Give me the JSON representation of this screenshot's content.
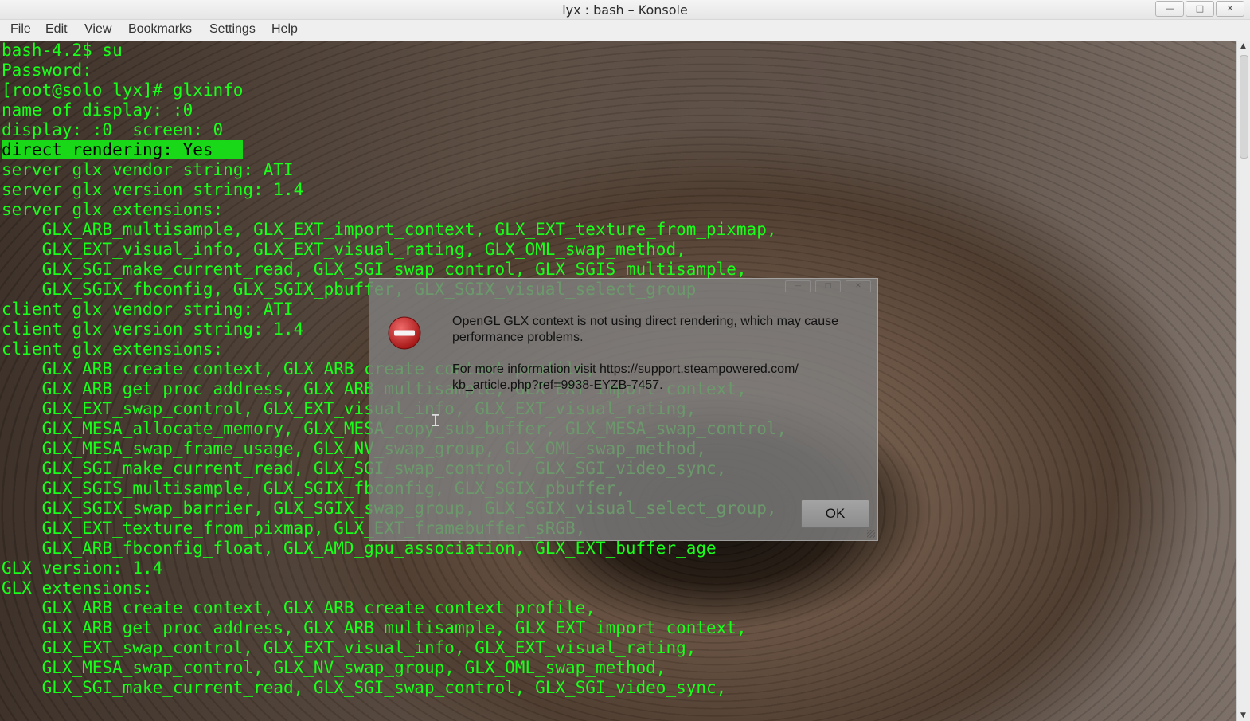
{
  "window": {
    "title": "lyx : bash – Konsole",
    "controls": [
      "minimize-icon",
      "maximize-icon",
      "close-icon"
    ]
  },
  "menubar": {
    "items": [
      "File",
      "Edit",
      "View",
      "Bookmarks",
      "Settings",
      "Help"
    ]
  },
  "terminal": {
    "text_color": "#1aff1a",
    "highlight_color": "#18d818",
    "lines": [
      "bash-4.2$ su",
      "Password:",
      "[root@solo lyx]# glxinfo",
      "name of display: :0",
      "display: :0  screen: 0",
      "direct rendering: Yes   ",
      "server glx vendor string: ATI",
      "server glx version string: 1.4",
      "server glx extensions:",
      "    GLX_ARB_multisample, GLX_EXT_import_context, GLX_EXT_texture_from_pixmap,",
      "    GLX_EXT_visual_info, GLX_EXT_visual_rating, GLX_OML_swap_method,",
      "    GLX_SGI_make_current_read, GLX_SGI_swap_control, GLX_SGIS_multisample,",
      "    GLX_SGIX_fbconfig, GLX_SGIX_pbuffer, GLX_SGIX_visual_select_group",
      "client glx vendor string: ATI",
      "client glx version string: 1.4",
      "client glx extensions:",
      "    GLX_ARB_create_context, GLX_ARB_create_context_profile,",
      "    GLX_ARB_get_proc_address, GLX_ARB_multisample, GLX_EXT_import_context,",
      "    GLX_EXT_swap_control, GLX_EXT_visual_info, GLX_EXT_visual_rating,",
      "    GLX_MESA_allocate_memory, GLX_MESA_copy_sub_buffer, GLX_MESA_swap_control,",
      "    GLX_MESA_swap_frame_usage, GLX_NV_swap_group, GLX_OML_swap_method,",
      "    GLX_SGI_make_current_read, GLX_SGI_swap_control, GLX_SGI_video_sync,",
      "    GLX_SGIS_multisample, GLX_SGIX_fbconfig, GLX_SGIX_pbuffer,",
      "    GLX_SGIX_swap_barrier, GLX_SGIX_swap_group, GLX_SGIX_visual_select_group,",
      "    GLX_EXT_texture_from_pixmap, GLX_EXT_framebuffer_sRGB,",
      "    GLX_ARB_fbconfig_float, GLX_AMD_gpu_association, GLX_EXT_buffer_age",
      "GLX version: 1.4",
      "GLX extensions:",
      "    GLX_ARB_create_context, GLX_ARB_create_context_profile,",
      "    GLX_ARB_get_proc_address, GLX_ARB_multisample, GLX_EXT_import_context,",
      "    GLX_EXT_swap_control, GLX_EXT_visual_info, GLX_EXT_visual_rating,",
      "    GLX_MESA_swap_control, GLX_NV_swap_group, GLX_OML_swap_method,",
      "    GLX_SGI_make_current_read, GLX_SGI_swap_control, GLX_SGI_video_sync,"
    ],
    "highlighted_line_index": 5
  },
  "dialog": {
    "icon": "stop-icon",
    "message": "OpenGL GLX context is not using direct rendering, which may cause performance problems.",
    "info": "For more information visit https://support.steampowered.com/ kb_article.php?ref=9938-EYZB-7457.",
    "ok_label": "OK",
    "controls": [
      "minimize-icon",
      "maximize-icon",
      "close-icon"
    ]
  }
}
